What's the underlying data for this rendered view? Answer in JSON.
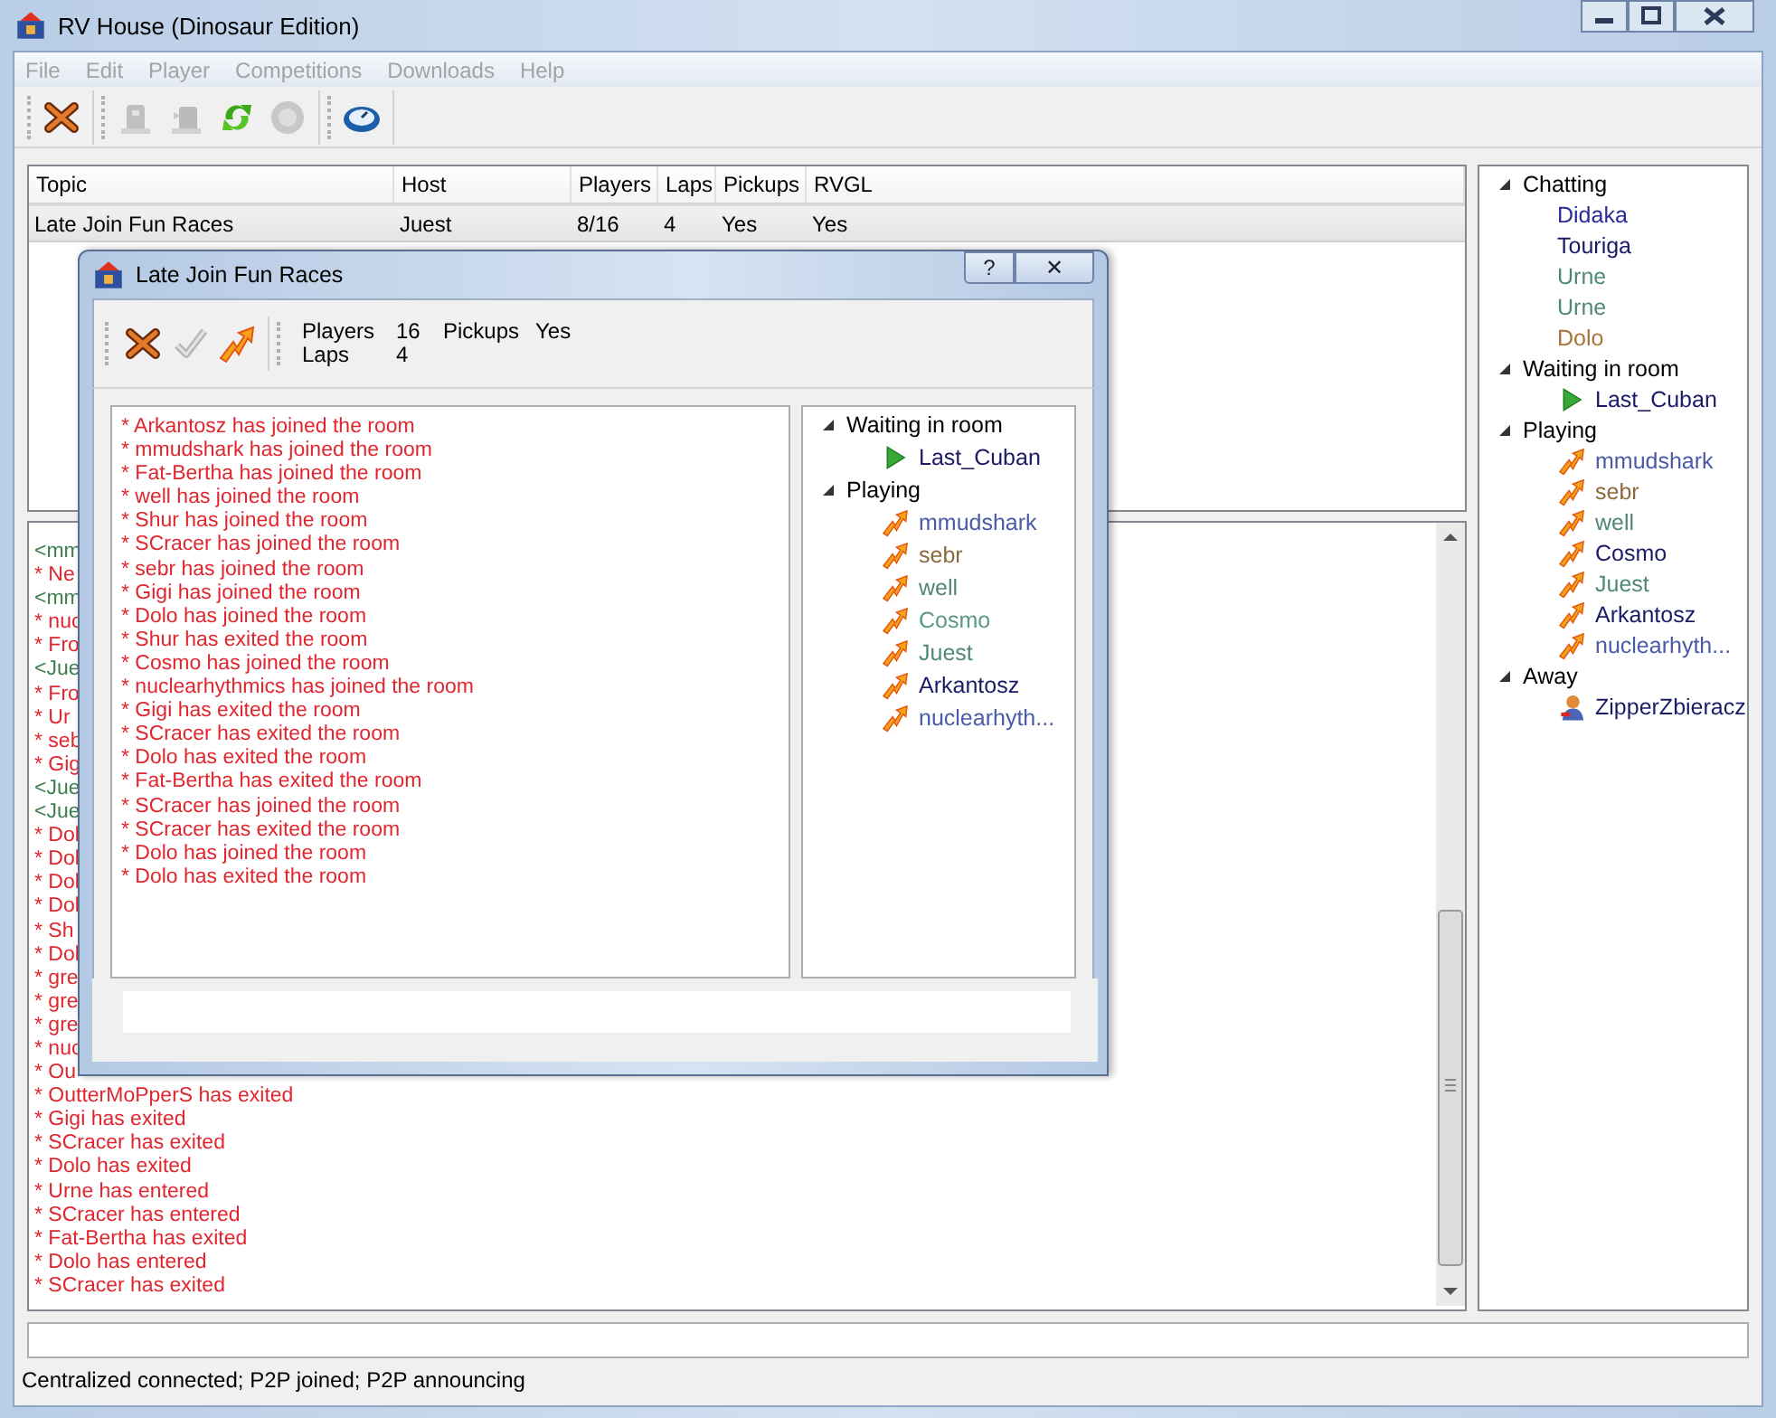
{
  "window": {
    "title": "RV House (Dinosaur Edition)"
  },
  "menu": [
    {
      "label": "File",
      "disabled": true
    },
    {
      "label": "Edit",
      "disabled": true
    },
    {
      "label": "Player",
      "disabled": true
    },
    {
      "label": "Competitions",
      "disabled": true
    },
    {
      "label": "Downloads",
      "disabled": true
    },
    {
      "label": "Help",
      "disabled": true
    }
  ],
  "toolbar": [
    [
      {
        "kind": "cross",
        "disabled": false
      }
    ],
    [
      {
        "kind": "building",
        "disabled": true
      },
      {
        "kind": "building-flag",
        "disabled": true
      },
      {
        "kind": "refresh",
        "disabled": false
      },
      {
        "kind": "disc",
        "disabled": true
      }
    ],
    [
      {
        "kind": "compass",
        "disabled": false
      }
    ]
  ],
  "rooms": {
    "columns": [
      "Topic",
      "Host",
      "Players",
      "Laps",
      "Pickups",
      "RVGL"
    ],
    "rows": [
      {
        "cells": [
          "Late Join Fun Races",
          "Juest",
          "8/16",
          "4",
          "Yes",
          "Yes"
        ],
        "selected": true
      }
    ]
  },
  "chat": [
    {
      "kind": "chat",
      "text": "<mm"
    },
    {
      "kind": "event",
      "text": "* Ne"
    },
    {
      "kind": "chat",
      "text": "<mm"
    },
    {
      "kind": "event",
      "text": "* nuc"
    },
    {
      "kind": "event",
      "text": "* Fro"
    },
    {
      "kind": "chat",
      "text": "<Jue"
    },
    {
      "kind": "event",
      "text": "* Fro"
    },
    {
      "kind": "event",
      "text": "* Ur"
    },
    {
      "kind": "event",
      "text": "* seb"
    },
    {
      "kind": "event",
      "text": "* Gig"
    },
    {
      "kind": "chat",
      "text": "<Jue"
    },
    {
      "kind": "chat",
      "text": "<Jue"
    },
    {
      "kind": "event",
      "text": "* Dol"
    },
    {
      "kind": "event",
      "text": "* Dol"
    },
    {
      "kind": "event",
      "text": "* Dol"
    },
    {
      "kind": "event",
      "text": "* Dol"
    },
    {
      "kind": "event",
      "text": "* Sh"
    },
    {
      "kind": "event",
      "text": "* Dol"
    },
    {
      "kind": "event",
      "text": "* gre"
    },
    {
      "kind": "event",
      "text": "* gre"
    },
    {
      "kind": "event",
      "text": "* gre"
    },
    {
      "kind": "event",
      "text": "* nuc"
    },
    {
      "kind": "event",
      "text": "* Ou"
    },
    {
      "kind": "event",
      "text": "* OutterMoPperS has exited"
    },
    {
      "kind": "event",
      "text": "* Gigi has exited"
    },
    {
      "kind": "event",
      "text": "* SCracer has exited"
    },
    {
      "kind": "event",
      "text": "* Dolo has exited"
    },
    {
      "kind": "event",
      "text": "* Urne has entered"
    },
    {
      "kind": "event",
      "text": "* SCracer has entered"
    },
    {
      "kind": "event",
      "text": "* Fat-Bertha has exited"
    },
    {
      "kind": "event",
      "text": "* Dolo has entered"
    },
    {
      "kind": "event",
      "text": "* SCracer has exited"
    }
  ],
  "users": [
    {
      "label": "Chatting",
      "expanded": true,
      "members": [
        {
          "name": "Didaka",
          "color": "#2b2b9b",
          "kind": "chatting"
        },
        {
          "name": "Touriga",
          "color": "#1a1a66",
          "kind": "chatting"
        },
        {
          "name": "Urne",
          "color": "#4f8a70",
          "kind": "chatting"
        },
        {
          "name": "Urne",
          "color": "#4f8a70",
          "kind": "chatting"
        },
        {
          "name": "Dolo",
          "color": "#a8743a",
          "kind": "chatting"
        }
      ]
    },
    {
      "label": "Waiting in room",
      "expanded": true,
      "members": [
        {
          "name": "Last_Cuban",
          "color": "#1a1a66",
          "kind": "waiting"
        }
      ]
    },
    {
      "label": "Playing",
      "expanded": true,
      "members": [
        {
          "name": "mmudshark",
          "color": "#4a5aa8",
          "kind": "playing"
        },
        {
          "name": "sebr",
          "color": "#8a6a3a",
          "kind": "playing"
        },
        {
          "name": "well",
          "color": "#4f8a70",
          "kind": "playing"
        },
        {
          "name": "Cosmo",
          "color": "#1a1a66",
          "kind": "playing"
        },
        {
          "name": "Juest",
          "color": "#4f8a70",
          "kind": "playing"
        },
        {
          "name": "Arkantosz",
          "color": "#1a1a66",
          "kind": "playing"
        },
        {
          "name": "nuclearhyth...",
          "color": "#4a5aa8",
          "kind": "playing"
        }
      ]
    },
    {
      "label": "Away",
      "expanded": true,
      "members": [
        {
          "name": "ZipperZbieracz",
          "color": "#1a1a66",
          "kind": "away"
        }
      ]
    }
  ],
  "status_bar": "Centralized connected; P2P joined; P2P announcing",
  "dialog": {
    "title": "Late Join Fun Races",
    "title_buttons": [
      "?",
      "✕"
    ],
    "toolbar": [
      {
        "kind": "cross",
        "disabled": false
      },
      {
        "kind": "check",
        "disabled": true
      },
      {
        "kind": "arrow",
        "disabled": false
      }
    ],
    "info": [
      [
        "Players",
        "16",
        "Pickups",
        "Yes"
      ],
      [
        "Laps",
        "4"
      ]
    ],
    "log": [
      "* Arkantosz has joined the room",
      "* mmudshark has joined the room",
      "* Fat-Bertha has joined the room",
      "* well has joined the room",
      "* Shur has joined the room",
      "* SCracer has joined the room",
      "* sebr has joined the room",
      "* Gigi has joined the room",
      "* Dolo has joined the room",
      "* Shur has exited the room",
      "* Cosmo has joined the room",
      "* nuclearhythmics has joined the room",
      "* Gigi has exited the room",
      "* SCracer has exited the room",
      "* Dolo has exited the room",
      "* Fat-Bertha has exited the room",
      "* SCracer has joined the room",
      "* SCracer has exited the room",
      "* Dolo has joined the room",
      "* Dolo has exited the room"
    ],
    "users": [
      {
        "label": "Waiting in room",
        "expanded": true,
        "members": [
          {
            "name": "Last_Cuban",
            "color": "#1a1a66",
            "kind": "waiting"
          }
        ]
      },
      {
        "label": "Playing",
        "expanded": true,
        "members": [
          {
            "name": "mmudshark",
            "color": "#4a5aa8",
            "kind": "playing"
          },
          {
            "name": "sebr",
            "color": "#8a6a3a",
            "kind": "playing"
          },
          {
            "name": "well",
            "color": "#4f8a70",
            "kind": "playing"
          },
          {
            "name": "Cosmo",
            "color": "#5a9a80",
            "kind": "playing"
          },
          {
            "name": "Juest",
            "color": "#4f8a70",
            "kind": "playing"
          },
          {
            "name": "Arkantosz",
            "color": "#1a1a66",
            "kind": "playing"
          },
          {
            "name": "nuclearhyth...",
            "color": "#4a5aa8",
            "kind": "playing"
          }
        ]
      }
    ]
  }
}
